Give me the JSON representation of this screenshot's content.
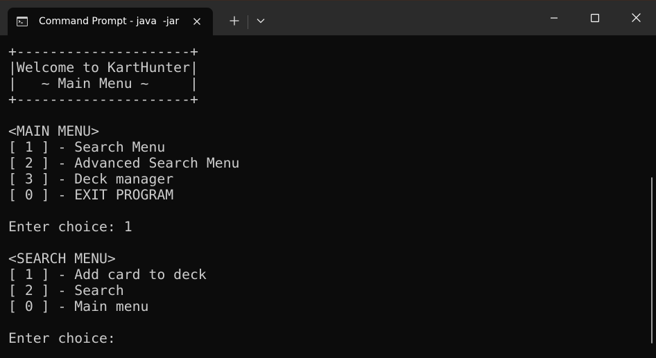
{
  "tab": {
    "title": "Command Prompt - java  -jar",
    "icon": "terminal-icon"
  },
  "window_controls": {
    "minimize": "minimize-icon",
    "maximize": "maximize-icon",
    "close": "close-icon"
  },
  "console": {
    "lines": [
      "+---------------------+",
      "|Welcome to KartHunter|",
      "|   ~ Main Menu ~     |",
      "+---------------------+",
      "",
      "<MAIN MENU>",
      "[ 1 ] - Search Menu",
      "[ 2 ] - Advanced Search Menu",
      "[ 3 ] - Deck manager",
      "[ 0 ] - EXIT PROGRAM",
      "",
      "Enter choice: 1",
      "",
      "<SEARCH MENU>",
      "[ 1 ] - Add card to deck",
      "[ 2 ] - Search",
      "[ 0 ] - Main menu",
      "",
      "Enter choice: "
    ]
  },
  "colors": {
    "console_bg": "#0c0c0c",
    "console_fg": "#cccccc",
    "titlebar_bg": "#2b2b2b"
  }
}
